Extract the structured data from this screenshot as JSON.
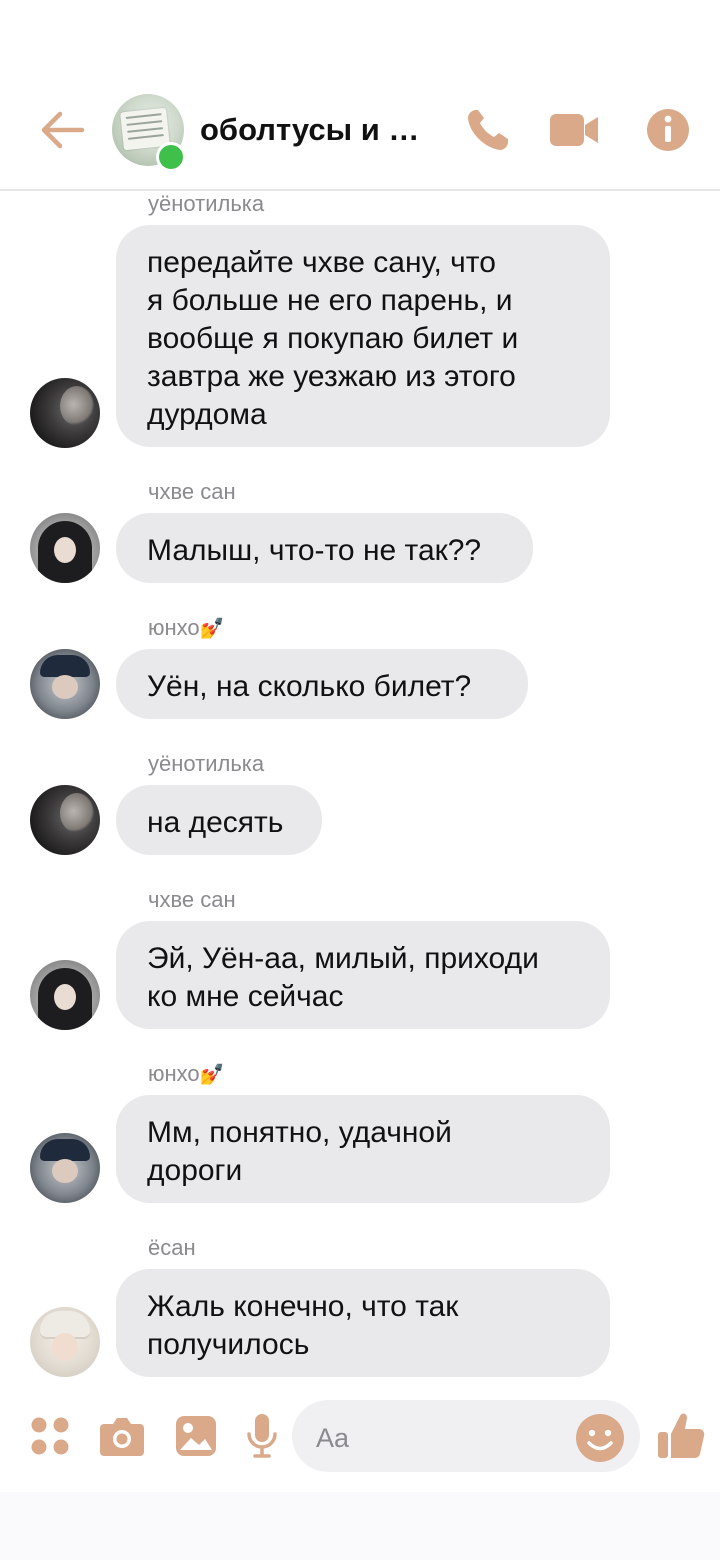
{
  "colors": {
    "accent": "#d9a98a",
    "bubble": "#e9e9ec",
    "online": "#3fc04a",
    "sender": "#8a8a8f"
  },
  "header": {
    "title": "оболтусы и …",
    "icons": [
      "back-arrow-icon",
      "phone-icon",
      "video-camera-icon",
      "info-icon"
    ]
  },
  "messages": [
    {
      "sender": "уёнотилька",
      "text": [
        "передайте чхве сану, что",
        "я больше не его парень, и",
        "вообще я покупаю билет и",
        "завтра же уезжаю из этого",
        "дурдома"
      ]
    },
    {
      "sender": "чхве сан",
      "text": [
        "Малыш, что-то не так??"
      ]
    },
    {
      "sender": "юнхо",
      "sender_emoji": "💅",
      "text": [
        "Уён, на сколько билет?"
      ]
    },
    {
      "sender": "уёнотилька",
      "text": [
        "на десять"
      ]
    },
    {
      "sender": "чхве сан",
      "text": [
        "Эй, Уён-аа, милый, приходи",
        "ко мне сейчас"
      ]
    },
    {
      "sender": "юнхо",
      "sender_emoji": "💅",
      "text": [
        "Мм, понятно, удачной",
        "дороги"
      ]
    },
    {
      "sender": "ёсан",
      "text": [
        "Жаль конечно, что так",
        "получилось"
      ]
    }
  ],
  "composer": {
    "placeholder": "Aa",
    "icons": [
      "apps-grid-icon",
      "camera-icon",
      "image-icon",
      "microphone-icon",
      "emoji-icon",
      "thumbs-up-icon"
    ]
  }
}
